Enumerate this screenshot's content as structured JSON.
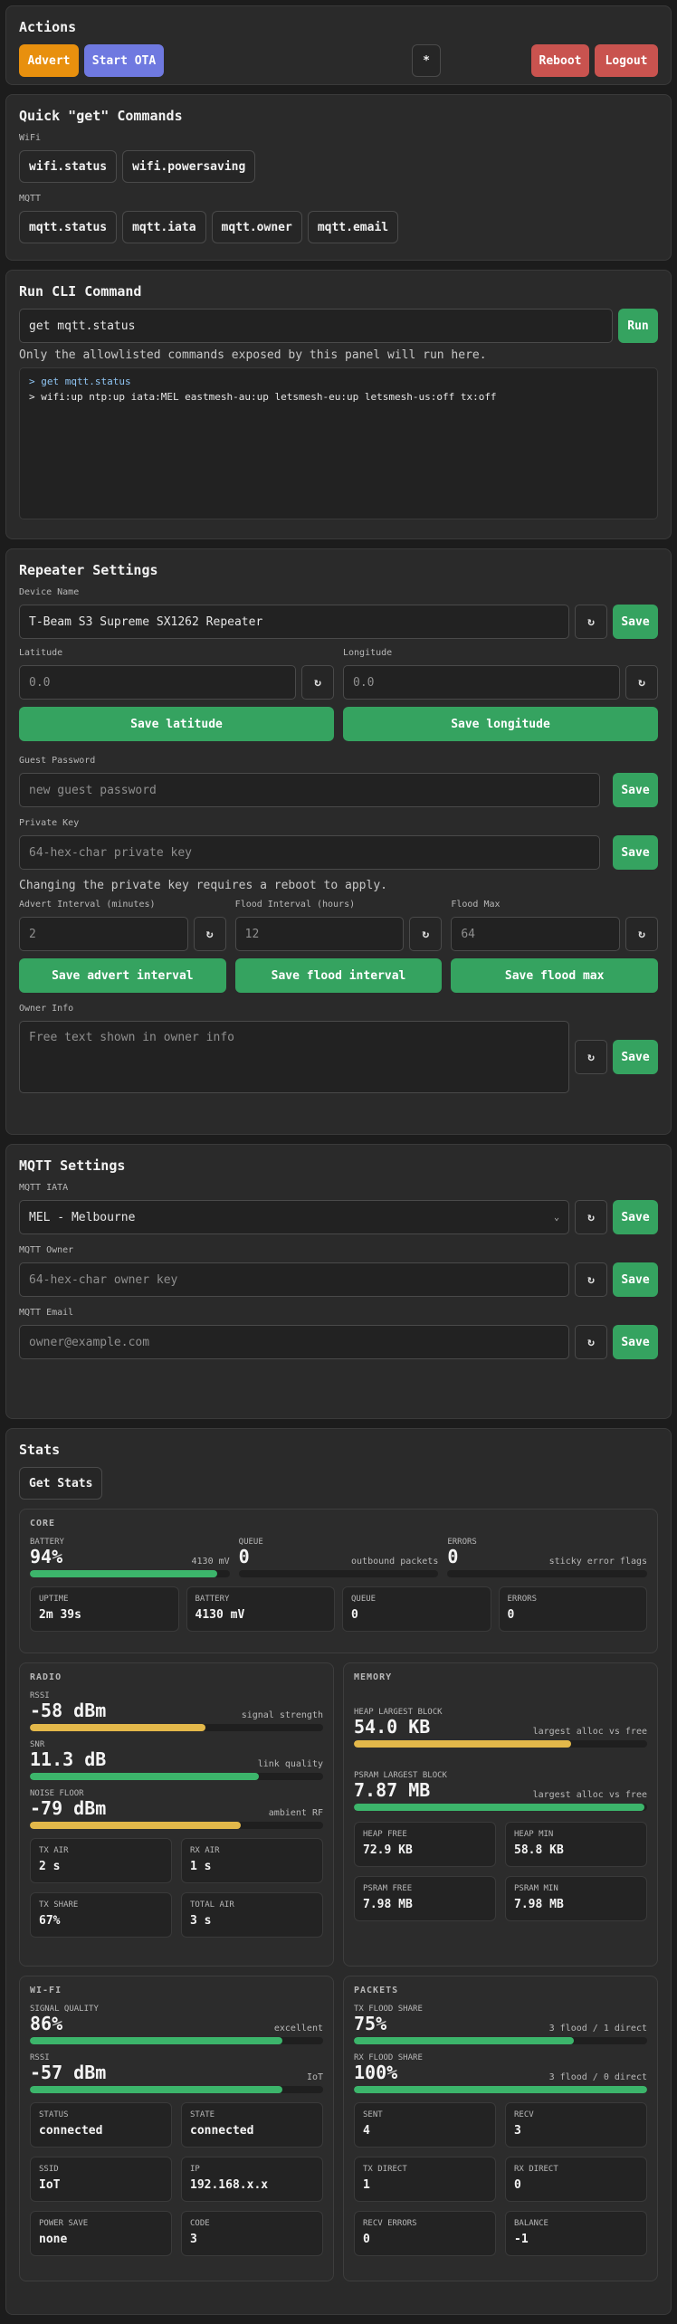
{
  "actions": {
    "title": "Actions",
    "advert": "Advert",
    "start_ota": "Start OTA",
    "star": "*",
    "reboot": "Reboot",
    "logout": "Logout"
  },
  "quick": {
    "title": "Quick \"get\" Commands",
    "wifi_label": "WiFi",
    "wifi_cmds": [
      "wifi.status",
      "wifi.powersaving"
    ],
    "mqtt_label": "MQTT",
    "mqtt_cmds": [
      "mqtt.status",
      "mqtt.iata",
      "mqtt.owner",
      "mqtt.email"
    ]
  },
  "cli": {
    "title": "Run CLI Command",
    "input_value": "get mqtt.status",
    "run": "Run",
    "note": "Only the allowlisted commands exposed by this panel will run here.",
    "output_line1": "> get mqtt.status",
    "output_line2": "> wifi:up ntp:up iata:MEL eastmesh-au:up letsmesh-eu:up letsmesh-us:off tx:off"
  },
  "repeater": {
    "title": "Repeater Settings",
    "device_name_label": "Device Name",
    "device_name_value": "T-Beam S3 Supreme SX1262 Repeater",
    "latitude_label": "Latitude",
    "latitude_placeholder": "0.0",
    "longitude_label": "Longitude",
    "longitude_placeholder": "0.0",
    "save_latitude": "Save latitude",
    "save_longitude": "Save longitude",
    "guest_password_label": "Guest Password",
    "guest_password_placeholder": "new guest password",
    "private_key_label": "Private Key",
    "private_key_placeholder": "64-hex-char private key",
    "reboot_note": "Changing the private key requires a reboot to apply.",
    "advert_interval_label": "Advert Interval (minutes)",
    "advert_interval_placeholder": "2",
    "flood_interval_label": "Flood Interval (hours)",
    "flood_interval_placeholder": "12",
    "flood_max_label": "Flood Max",
    "flood_max_placeholder": "64",
    "save_advert_interval": "Save advert interval",
    "save_flood_interval": "Save flood interval",
    "save_flood_max": "Save flood max",
    "owner_info_label": "Owner Info",
    "owner_info_placeholder": "Free text shown in owner info",
    "save": "Save",
    "refresh": "↻"
  },
  "mqtt": {
    "title": "MQTT Settings",
    "iata_label": "MQTT IATA",
    "iata_value": "MEL - Melbourne",
    "owner_label": "MQTT Owner",
    "owner_placeholder": "64-hex-char owner key",
    "email_label": "MQTT Email",
    "email_placeholder": "owner@example.com"
  },
  "stats": {
    "title": "Stats",
    "get_stats": "Get Stats",
    "core": {
      "title": "CORE",
      "battery_label": "BATTERY",
      "battery_value": "94%",
      "battery_hint": "4130 mV",
      "battery_level": 94,
      "queue_label": "QUEUE",
      "queue_value": "0",
      "queue_hint": "outbound packets",
      "queue_level": 0,
      "errors_label": "ERRORS",
      "errors_value": "0",
      "errors_hint": "sticky error flags",
      "errors_level": 0,
      "tiles": [
        {
          "label": "UPTIME",
          "value": "2m 39s"
        },
        {
          "label": "BATTERY",
          "value": "4130 mV"
        },
        {
          "label": "QUEUE",
          "value": "0"
        },
        {
          "label": "ERRORS",
          "value": "0"
        }
      ]
    },
    "radio": {
      "title": "RADIO",
      "rssi_label": "RSSI",
      "rssi_value": "-58 dBm",
      "rssi_hint": "signal strength",
      "rssi_level": 60,
      "snr_label": "SNR",
      "snr_value": "11.3 dB",
      "snr_hint": "link quality",
      "snr_level": 78,
      "noise_label": "NOISE FLOOR",
      "noise_value": "-79 dBm",
      "noise_hint": "ambient RF",
      "noise_level": 72,
      "tiles": [
        {
          "label": "TX AIR",
          "value": "2 s"
        },
        {
          "label": "RX AIR",
          "value": "1 s"
        },
        {
          "label": "TX SHARE",
          "value": "67%"
        },
        {
          "label": "TOTAL AIR",
          "value": "3 s"
        }
      ]
    },
    "memory": {
      "title": "MEMORY",
      "heap_label": "HEAP LARGEST BLOCK",
      "heap_value": "54.0 KB",
      "heap_hint": "largest alloc vs free",
      "heap_level": 74,
      "psram_label": "PSRAM LARGEST BLOCK",
      "psram_value": "7.87 MB",
      "psram_hint": "largest alloc vs free",
      "psram_level": 99,
      "tiles": [
        {
          "label": "HEAP FREE",
          "value": "72.9 KB"
        },
        {
          "label": "HEAP MIN",
          "value": "58.8 KB"
        },
        {
          "label": "PSRAM FREE",
          "value": "7.98 MB"
        },
        {
          "label": "PSRAM MIN",
          "value": "7.98 MB"
        }
      ]
    },
    "wifi": {
      "title": "WI-FI",
      "signal_label": "SIGNAL QUALITY",
      "signal_value": "86%",
      "signal_hint": "excellent",
      "signal_level": 86,
      "rssi_label": "RSSI",
      "rssi_value": "-57 dBm",
      "rssi_hint": "IoT",
      "rssi_level": 86,
      "tiles": [
        {
          "label": "STATUS",
          "value": "connected"
        },
        {
          "label": "STATE",
          "value": "connected"
        },
        {
          "label": "SSID",
          "value": "IoT"
        },
        {
          "label": "IP",
          "value": "192.168.x.x"
        },
        {
          "label": "POWER SAVE",
          "value": "none"
        },
        {
          "label": "CODE",
          "value": "3"
        }
      ]
    },
    "packets": {
      "title": "PACKETS",
      "tx_label": "TX FLOOD SHARE",
      "tx_value": "75%",
      "tx_hint": "3 flood / 1 direct",
      "tx_level": 75,
      "rx_label": "RX FLOOD SHARE",
      "rx_value": "100%",
      "rx_hint": "3 flood / 0 direct",
      "rx_level": 100,
      "tiles": [
        {
          "label": "SENT",
          "value": "4"
        },
        {
          "label": "RECV",
          "value": "3"
        },
        {
          "label": "TX DIRECT",
          "value": "1"
        },
        {
          "label": "RX DIRECT",
          "value": "0"
        },
        {
          "label": "RECV ERRORS",
          "value": "0"
        },
        {
          "label": "BALANCE",
          "value": "-1"
        }
      ]
    }
  },
  "colors": {
    "accent_green": "#35a360",
    "accent_orange": "#e8900e",
    "accent_purple": "#6f79e0",
    "accent_red": "#c9534f",
    "bar_yellow": "#e3b84a"
  }
}
